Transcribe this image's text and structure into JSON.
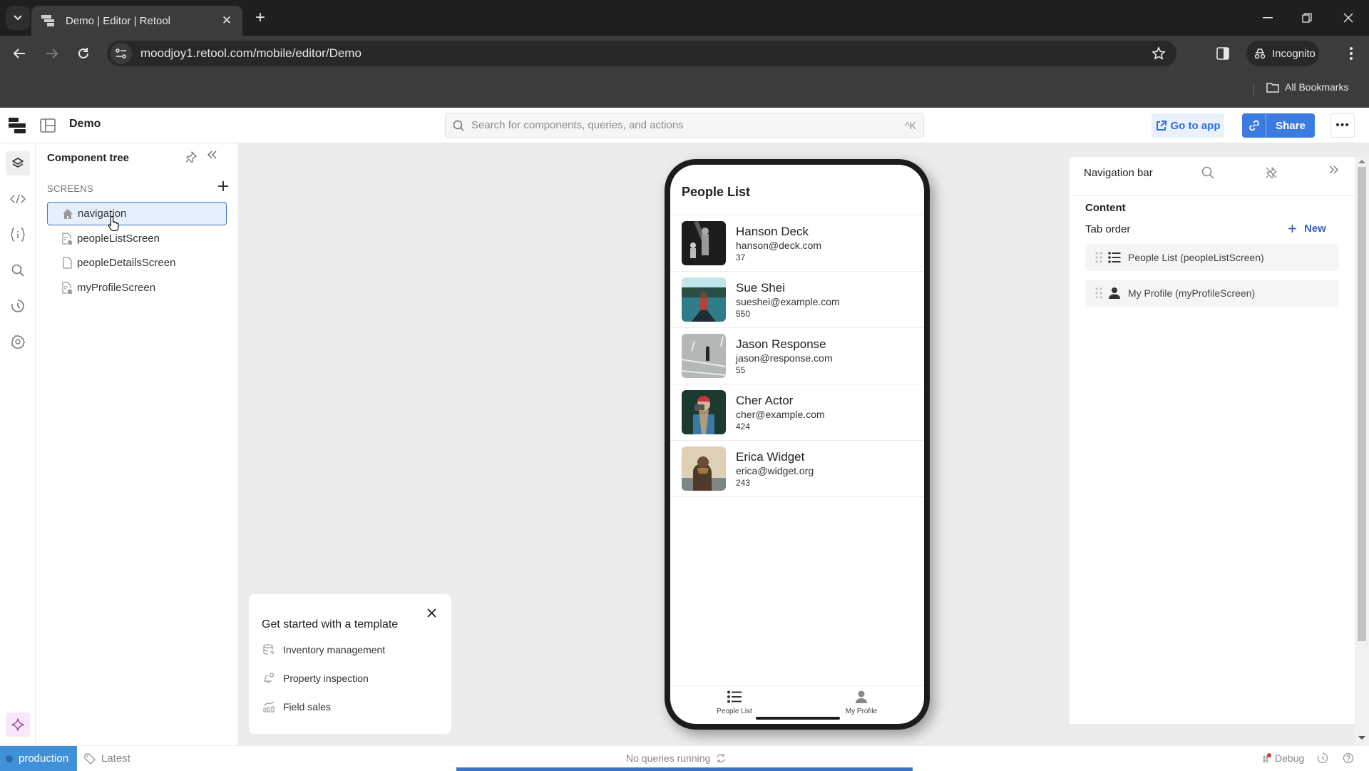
{
  "browser": {
    "tab_title": "Demo | Editor | Retool",
    "url": "moodjoy1.retool.com/mobile/editor/Demo",
    "profile_label": "Incognito",
    "bookmarks_label": "All Bookmarks"
  },
  "header": {
    "app_name": "Demo",
    "search_placeholder": "Search for components, queries, and actions",
    "search_shortcut": "^K",
    "go_to_app_label": "Go to app",
    "share_label": "Share",
    "more_label": "•••"
  },
  "left_rail": {
    "items": [
      {
        "icon": "layers-icon",
        "active": true
      },
      {
        "icon": "code-icon"
      },
      {
        "icon": "state-icon"
      },
      {
        "icon": "search-icon"
      },
      {
        "icon": "history-icon"
      },
      {
        "icon": "settings-icon"
      }
    ],
    "assist_icon": "sparkle-icon"
  },
  "component_tree": {
    "title": "Component tree",
    "section_label": "SCREENS",
    "screens": [
      {
        "label": "navigation",
        "icon": "home-icon",
        "selected": true
      },
      {
        "label": "peopleListScreen",
        "icon": "screen-home-icon"
      },
      {
        "label": "peopleDetailsScreen",
        "icon": "screen-icon"
      },
      {
        "label": "myProfileScreen",
        "icon": "screen-home-icon"
      }
    ]
  },
  "phone": {
    "screen_title": "People List",
    "people": [
      {
        "name": "Hanson Deck",
        "email": "hanson@deck.com",
        "value": "37",
        "photo_colors": [
          "#2a2a2a",
          "#888888"
        ]
      },
      {
        "name": "Sue Shei",
        "email": "sueshei@example.com",
        "value": "550",
        "photo_colors": [
          "#9fd3dc",
          "#1f5a63"
        ]
      },
      {
        "name": "Jason Response",
        "email": "jason@response.com",
        "value": "55",
        "photo_colors": [
          "#b9bcb8",
          "#8d918d"
        ]
      },
      {
        "name": "Cher Actor",
        "email": "cher@example.com",
        "value": "424",
        "photo_colors": [
          "#1d3b33",
          "#3f7fb0"
        ]
      },
      {
        "name": "Erica Widget",
        "email": "erica@widget.org",
        "value": "243",
        "photo_colors": [
          "#d8c9b0",
          "#4a3a2c"
        ]
      }
    ],
    "tabs": [
      {
        "label": "People List",
        "icon": "list-icon"
      },
      {
        "label": "My Profile",
        "icon": "person-icon"
      }
    ]
  },
  "template_card": {
    "title": "Get started with a template",
    "items": [
      {
        "label": "Inventory management",
        "icon": "database-icon"
      },
      {
        "label": "Property inspection",
        "icon": "bell-icon"
      },
      {
        "label": "Field sales",
        "icon": "chart-icon"
      }
    ]
  },
  "inspector": {
    "title": "Navigation bar",
    "content_label": "Content",
    "tab_order_label": "Tab order",
    "new_label": "New",
    "tab_items": [
      {
        "label": "People List (peopleListScreen)",
        "icon": "list-icon"
      },
      {
        "label": "My Profile (myProfileScreen)",
        "icon": "person-icon"
      }
    ]
  },
  "status_bar": {
    "environment": "production",
    "version": "Latest",
    "queries_status": "No queries running",
    "debug_label": "Debug"
  },
  "colors": {
    "accent": "#3b7be2",
    "environment": "#4091d8",
    "selection": "#e6f0fc",
    "new_link": "#3a5fc8"
  }
}
